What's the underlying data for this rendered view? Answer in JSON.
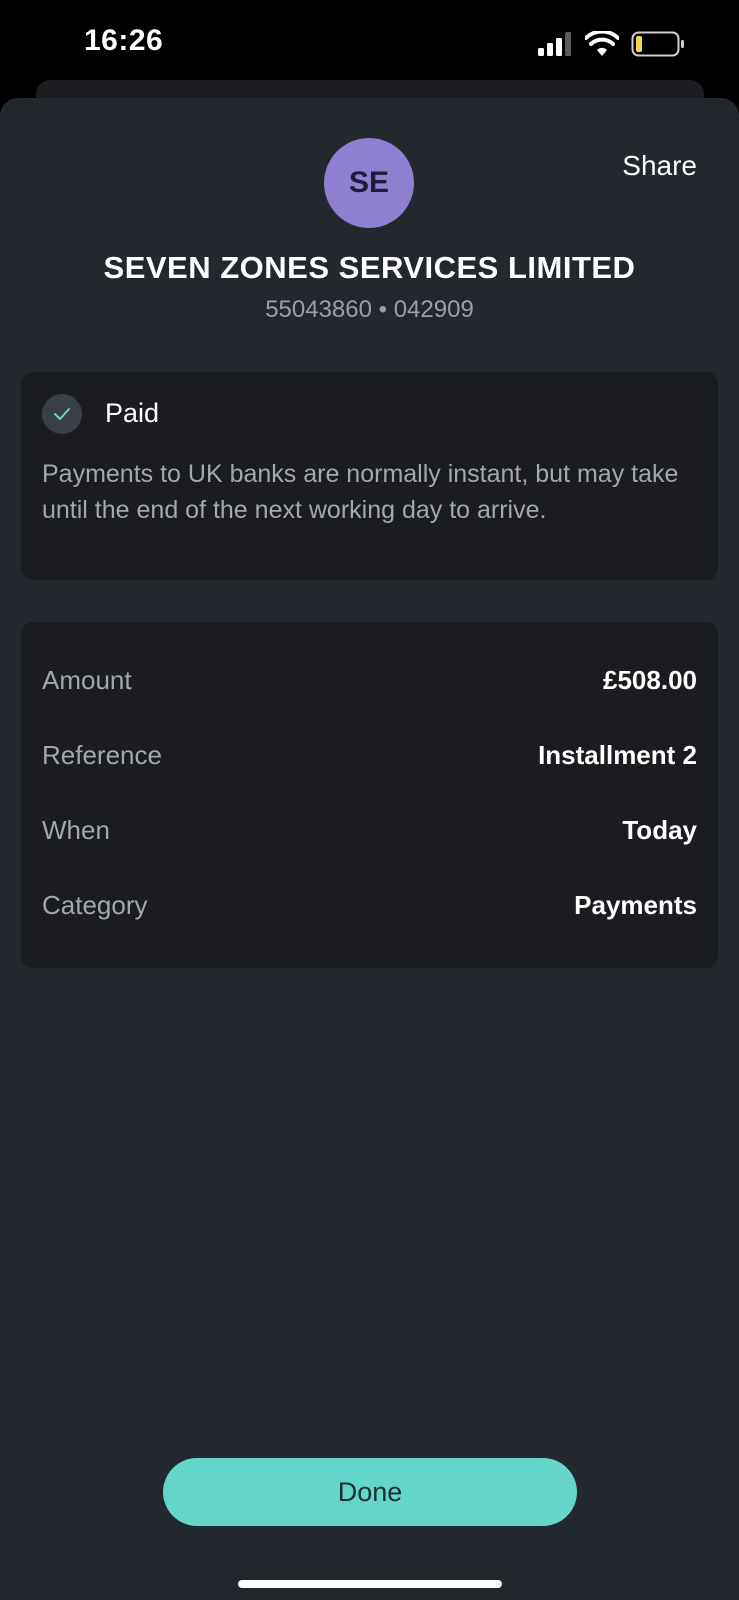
{
  "status_bar": {
    "time": "16:26",
    "icons": [
      "cellular-signal-icon",
      "wifi-icon",
      "battery-low-icon"
    ]
  },
  "header": {
    "avatar_initials": "SE",
    "share_label": "Share",
    "payee_name": "SEVEN ZONES SERVICES LIMITED",
    "account_info": "55043860 • 042909"
  },
  "status": {
    "label": "Paid",
    "icon": "check-icon",
    "description": "Payments to UK banks are normally instant, but may take until the end of the next working day to arrive."
  },
  "details": [
    {
      "label": "Amount",
      "value": "£508.00"
    },
    {
      "label": "Reference",
      "value": "Installment 2"
    },
    {
      "label": "When",
      "value": "Today"
    },
    {
      "label": "Category",
      "value": "Payments"
    }
  ],
  "footer": {
    "done_label": "Done"
  },
  "colors": {
    "sheet_background": "#23272e",
    "card_background": "#1a1c20",
    "avatar": "#8f7fd0",
    "accent_button": "#63d6c9",
    "check_green": "#6fd8a8",
    "battery_low": "#f5d547"
  }
}
